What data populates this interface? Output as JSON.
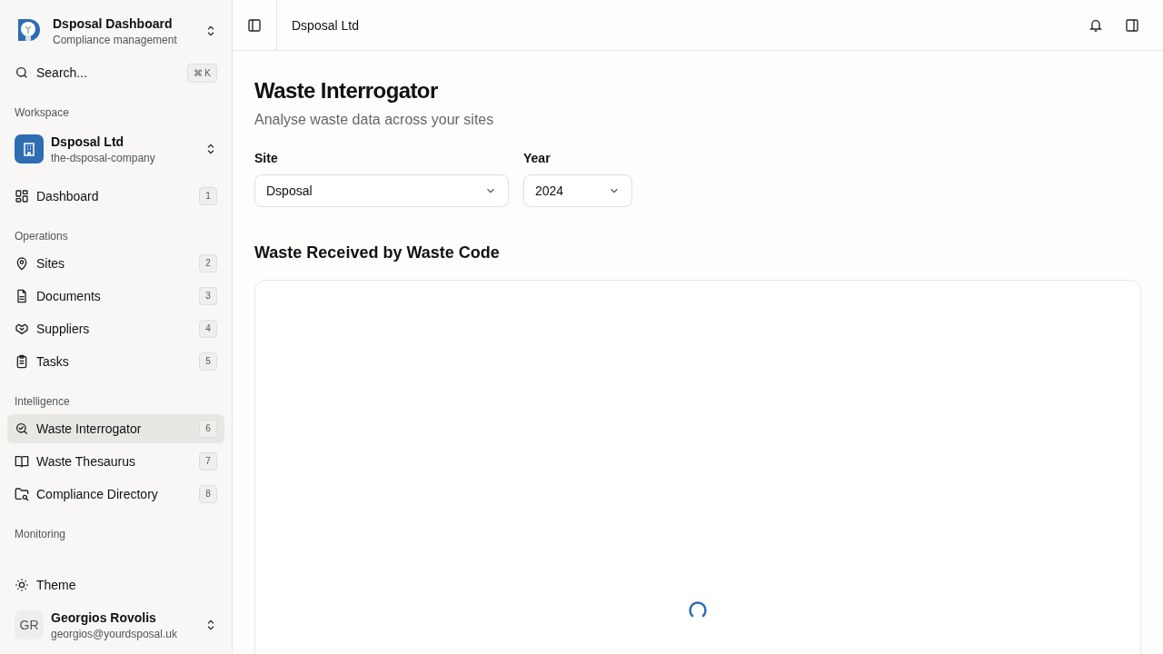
{
  "app": {
    "title": "Dsposal Dashboard",
    "subtitle": "Compliance management"
  },
  "search": {
    "placeholder": "Search...",
    "shortcut": "⌘ K"
  },
  "workspace": {
    "heading": "Workspace",
    "name": "Dsposal Ltd",
    "slug": "the-dsposal-company"
  },
  "nav_sections": [
    {
      "items": [
        {
          "label": "Dashboard",
          "shortcut": "1",
          "selected": false
        }
      ]
    },
    {
      "heading": "Operations",
      "items": [
        {
          "label": "Sites",
          "shortcut": "2",
          "selected": false
        },
        {
          "label": "Documents",
          "shortcut": "3",
          "selected": false
        },
        {
          "label": "Suppliers",
          "shortcut": "4",
          "selected": false
        },
        {
          "label": "Tasks",
          "shortcut": "5",
          "selected": false
        }
      ]
    },
    {
      "heading": "Intelligence",
      "items": [
        {
          "label": "Waste Interrogator",
          "shortcut": "6",
          "selected": true
        },
        {
          "label": "Waste Thesaurus",
          "shortcut": "7",
          "selected": false
        },
        {
          "label": "Compliance Directory",
          "shortcut": "8",
          "selected": false
        }
      ]
    },
    {
      "heading": "Monitoring"
    }
  ],
  "theme_button": "Theme",
  "user": {
    "initials": "GR",
    "name": "Georgios Rovolis",
    "email": "georgios@yourdsposal.uk"
  },
  "breadcrumb": "Dsposal Ltd",
  "page": {
    "title": "Waste Interrogator",
    "subtitle": "Analyse waste data across your sites"
  },
  "filters": [
    {
      "label": "Site",
      "value": "Dsposal"
    },
    {
      "label": "Year",
      "value": "2024"
    }
  ],
  "section_title": "Waste Received by Waste Code",
  "chart_loading": true
}
